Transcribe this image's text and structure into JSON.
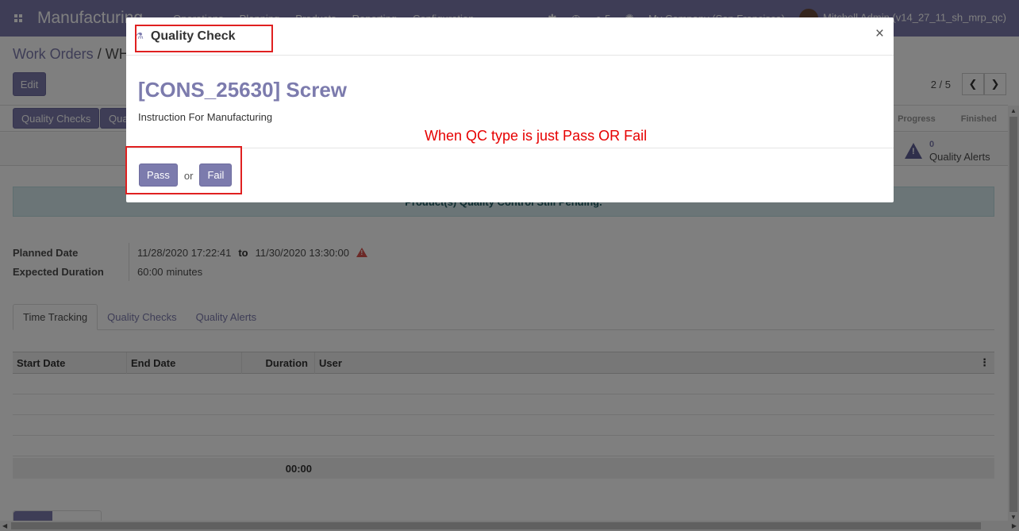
{
  "navbar": {
    "app_name": "Manufacturing",
    "menu": [
      "Operations",
      "Planning",
      "Products",
      "Reporting",
      "Configuration"
    ],
    "message_count": "5",
    "company": "My Company (San Francisco)",
    "user": "Mitchell Admin (v14_27_11_sh_mrp_qc)"
  },
  "control_panel": {
    "breadcrumb_root": "Work Orders",
    "breadcrumb_sep": " / ",
    "breadcrumb_current": "WH",
    "edit_label": "Edit",
    "pager_value": "2 / 5"
  },
  "form": {
    "header_buttons": [
      "Quality Checks",
      "Qua"
    ],
    "stages": [
      "Progress",
      "Finished"
    ],
    "smart_button": {
      "count": "0",
      "label": "Quality Alerts"
    },
    "alert_text": "Product(s) Quality Control Still Pending.",
    "fields": {
      "planned_date_label": "Planned Date",
      "planned_start": "11/28/2020 17:22:41",
      "to_word": "to",
      "planned_end": "11/30/2020 13:30:00",
      "expected_duration_label": "Expected Duration",
      "duration_value": "60:00",
      "duration_unit": "minutes"
    },
    "tabs": [
      "Time Tracking",
      "Quality Checks",
      "Quality Alerts"
    ],
    "table": {
      "columns": [
        "Start Date",
        "End Date",
        "Duration",
        "User"
      ],
      "total_duration": "00:00"
    }
  },
  "modal": {
    "title": "Quality Check",
    "product": "[CONS_25630] Screw",
    "instruction": "Instruction For Manufacturing",
    "pass_label": "Pass",
    "or_label": "or",
    "fail_label": "Fail",
    "close_symbol": "×"
  },
  "annotation": {
    "text": "When QC type is just Pass OR Fail",
    "color": "#e60000"
  },
  "colors": {
    "brand": "#7c7bad",
    "annotation_box": "#e02020"
  }
}
